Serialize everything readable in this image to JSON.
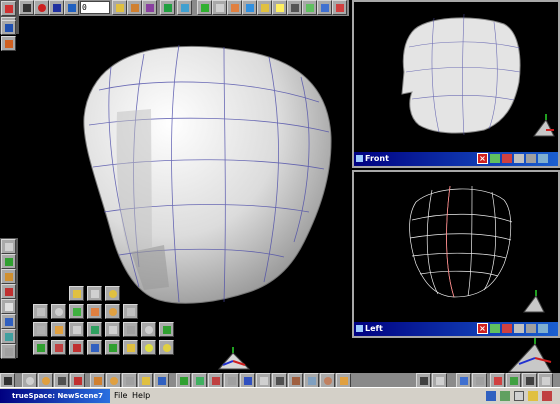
{
  "app": {
    "title": "trueSpace: NewScene7"
  },
  "top_toolbar": {
    "frame_value": "0"
  },
  "viewports": {
    "perspective": {
      "name": ""
    },
    "front": {
      "title": "Front"
    },
    "left": {
      "title": "Left"
    }
  },
  "status_bar": {
    "title": "trueSpace: NewScene7",
    "menu": [
      "File",
      "Help"
    ]
  },
  "colors": {
    "titlebar": "#000080",
    "toolbar": "#a9a9a9",
    "mesh": "#e6e6e6",
    "wireframe": "#ffffff"
  }
}
